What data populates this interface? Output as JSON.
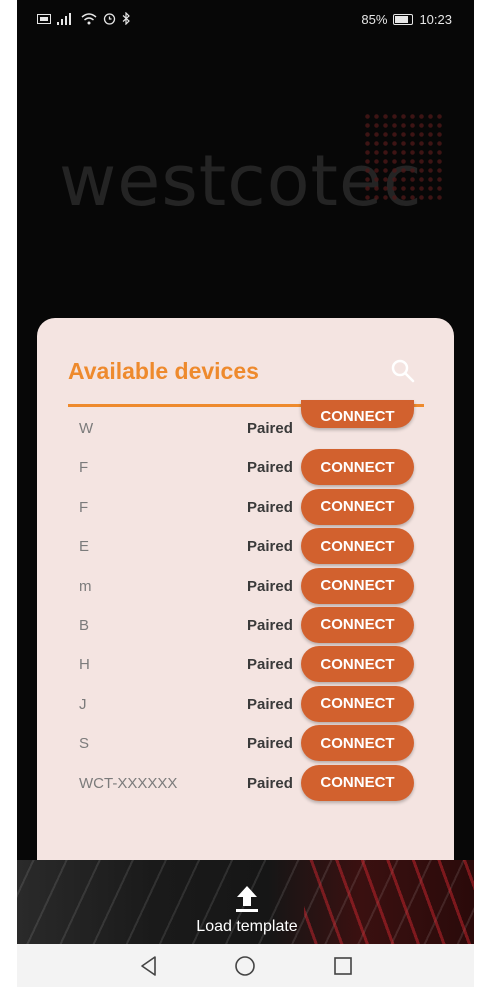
{
  "status_bar": {
    "carrier_icon": "sim-card-icon",
    "signal_icon": "signal-bars-icon",
    "wifi_icon": "wifi-icon",
    "alarm_icon": "alarm-icon",
    "bluetooth_icon": "bluetooth-icon",
    "battery": "85%",
    "time": "10:23"
  },
  "background_logo": "westcotec",
  "dialog": {
    "title": "Available devices",
    "search_icon": "search-icon",
    "devices": [
      {
        "name": "W",
        "status": "Paired",
        "action": "CONNECT"
      },
      {
        "name": "F",
        "status": "Paired",
        "action": "CONNECT"
      },
      {
        "name": "F",
        "status": "Paired",
        "action": "CONNECT"
      },
      {
        "name": "E",
        "status": "Paired",
        "action": "CONNECT"
      },
      {
        "name": "m",
        "status": "Paired",
        "action": "CONNECT"
      },
      {
        "name": "B",
        "status": "Paired",
        "action": "CONNECT"
      },
      {
        "name": "H",
        "status": "Paired",
        "action": "CONNECT"
      },
      {
        "name": "J",
        "status": "Paired",
        "action": "CONNECT"
      },
      {
        "name": "S",
        "status": "Paired",
        "action": "CONNECT"
      },
      {
        "name": "WCT-XXXXXX",
        "status": "Paired",
        "action": "CONNECT"
      }
    ]
  },
  "bottom_bar": {
    "upload_icon": "upload-arrow-icon",
    "load_label": "Load template"
  },
  "nav": {
    "back_icon": "back-triangle-icon",
    "home_icon": "home-circle-icon",
    "recents_icon": "recents-square-icon"
  },
  "colors": {
    "accent": "#ee8a2d",
    "button": "#d2612e",
    "dialog_bg": "#f4e4e1"
  }
}
